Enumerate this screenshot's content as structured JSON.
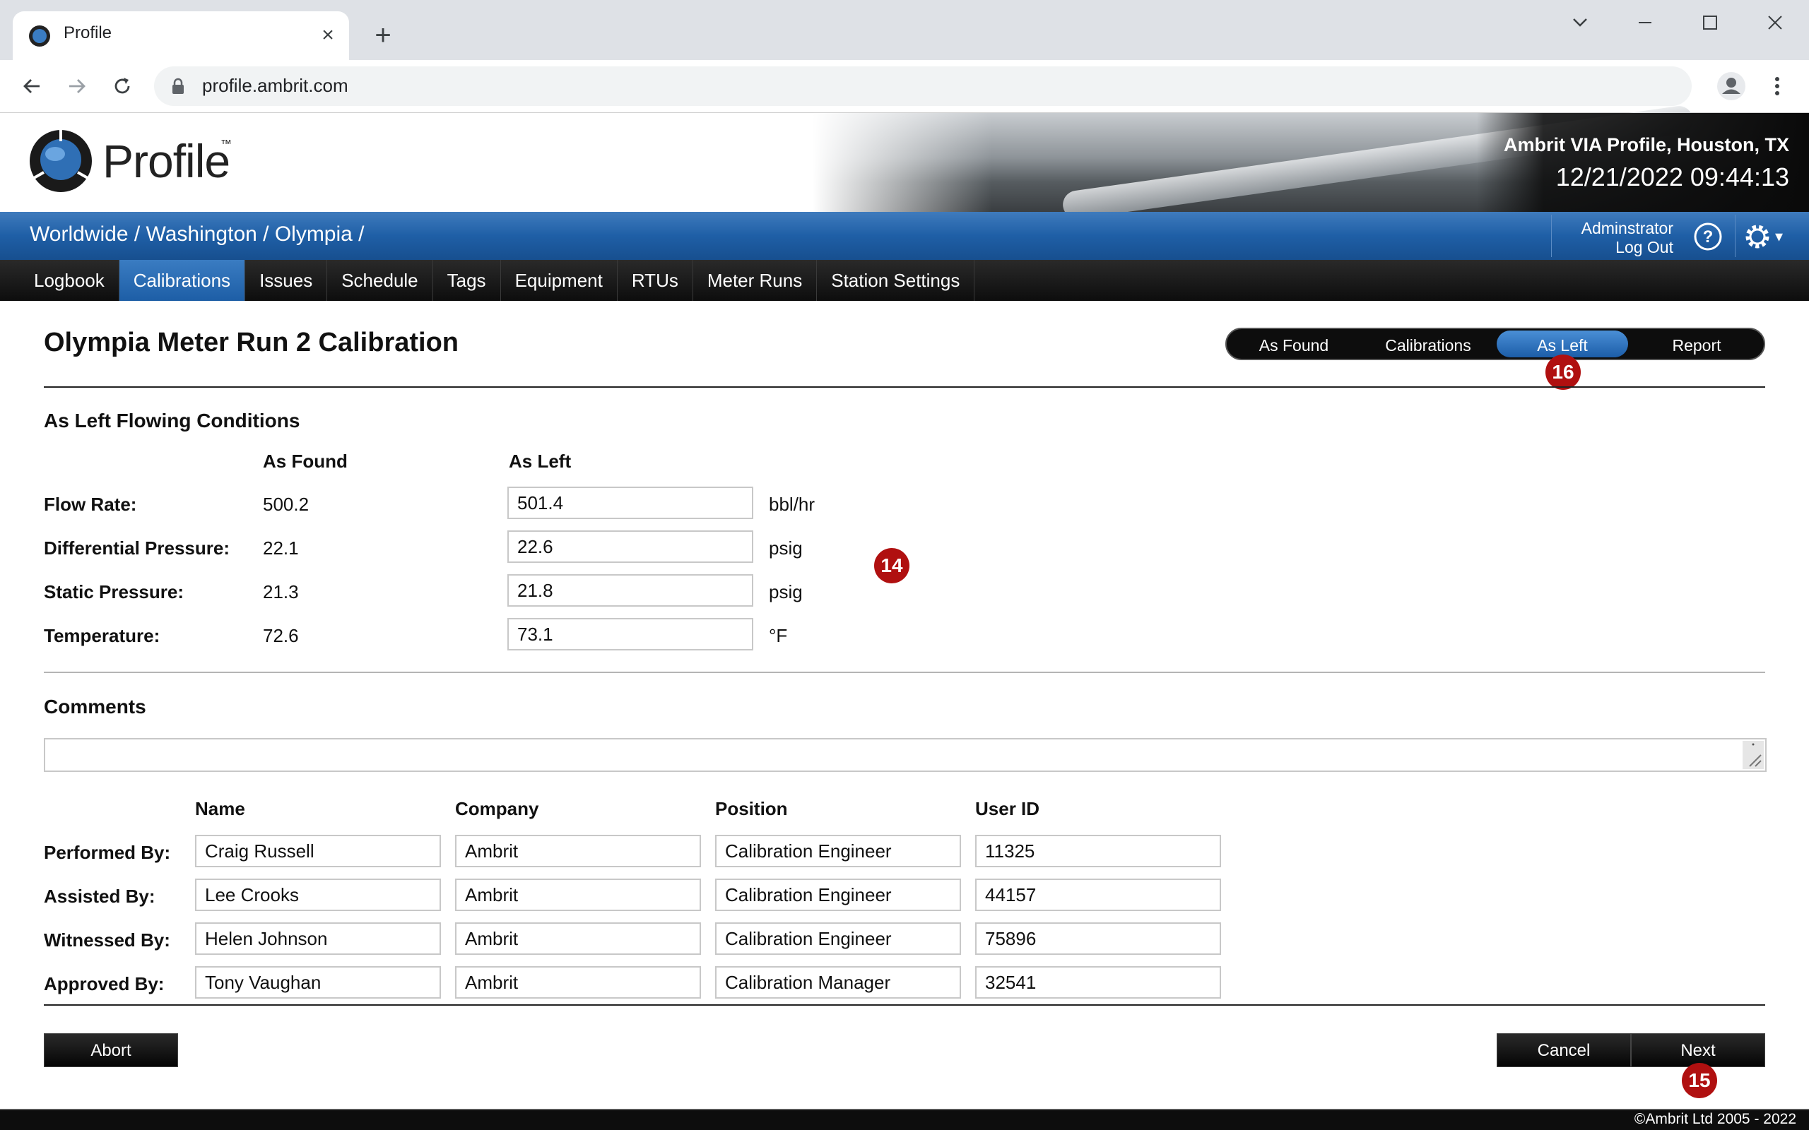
{
  "browser": {
    "tab_title": "Profile",
    "url": "profile.ambrit.com"
  },
  "header": {
    "logo_text": "Profile",
    "logo_tm": "™",
    "site_name": "Ambrit VIA Profile, Houston, TX",
    "datetime": "12/21/2022 09:44:13"
  },
  "breadcrumb": "Worldwide / Washington / Olympia /",
  "user": {
    "name": "Adminstrator",
    "logout": "Log Out"
  },
  "nav": {
    "items": [
      "Logbook",
      "Calibrations",
      "Issues",
      "Schedule",
      "Tags",
      "Equipment",
      "RTUs",
      "Meter Runs",
      "Station Settings"
    ],
    "active": "Calibrations"
  },
  "page": {
    "title": "Olympia Meter Run 2 Calibration",
    "steps": [
      "As Found",
      "Calibrations",
      "As Left",
      "Report"
    ],
    "active_step": "As Left",
    "markers": {
      "step": "16",
      "conditions": "14",
      "next": "15"
    }
  },
  "conditions": {
    "heading": "As Left Flowing Conditions",
    "col_found": "As Found",
    "col_left": "As Left",
    "rows": [
      {
        "label": "Flow Rate:",
        "found": "500.2",
        "left": "501.4",
        "unit": "bbl/hr"
      },
      {
        "label": "Differential Pressure:",
        "found": "22.1",
        "left": "22.6",
        "unit": "psig"
      },
      {
        "label": "Static Pressure:",
        "found": "21.3",
        "left": "21.8",
        "unit": "psig"
      },
      {
        "label": "Temperature:",
        "found": "72.6",
        "left": "73.1",
        "unit": "°F"
      }
    ]
  },
  "comments": {
    "heading": "Comments",
    "value": ""
  },
  "personnel": {
    "headers": [
      "Name",
      "Company",
      "Position",
      "User ID"
    ],
    "rows": [
      {
        "role": "Performed By:",
        "name": "Craig Russell",
        "company": "Ambrit",
        "position": "Calibration Engineer",
        "user_id": "11325"
      },
      {
        "role": "Assisted By:",
        "name": "Lee Crooks",
        "company": "Ambrit",
        "position": "Calibration Engineer",
        "user_id": "44157"
      },
      {
        "role": "Witnessed By:",
        "name": "Helen Johnson",
        "company": "Ambrit",
        "position": "Calibration Engineer",
        "user_id": "75896"
      },
      {
        "role": "Approved By:",
        "name": "Tony Vaughan",
        "company": "Ambrit",
        "position": "Calibration Manager",
        "user_id": "32541"
      }
    ]
  },
  "buttons": {
    "abort": "Abort",
    "cancel": "Cancel",
    "next": "Next"
  },
  "footer": {
    "copyright": "©Ambrit Ltd 2005 - 2022"
  },
  "colors": {
    "accent_blue": "#1f5fa6",
    "marker_red": "#b01010",
    "nav_black": "#0d0d0d"
  }
}
